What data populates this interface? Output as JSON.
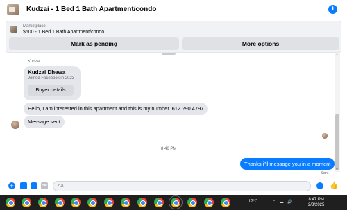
{
  "header": {
    "title": "Kudzai - 1 Bed 1 Bath Apartment/condo",
    "info_glyph": "i"
  },
  "marketplace": {
    "label": "Marketplace",
    "listing": "$600 - 1 Bed 1 Bath Apartment/condo",
    "pending_button": "Mark as pending",
    "more_button": "More options"
  },
  "messages": {
    "sender_small": "Kudzai",
    "profile_card": {
      "name": "Kudzai Dhewa",
      "joined": "Joined Facebook in 2023",
      "button": "Buyer details"
    },
    "incoming_1": "Hello, I am interested in this apartment and this is my number. 612 290 4797",
    "incoming_2": "Message sent",
    "timestamp": "8:46 PM",
    "outgoing": "Thanks i\"il message you in a moment",
    "sent_status": "Sent"
  },
  "composer": {
    "placeholder": "Aa",
    "gif_label": "GIF"
  },
  "taskbar": {
    "weather": "17°C",
    "time": "8:47 PM",
    "date": "2/3/2025"
  },
  "colors": {
    "accent": "#0a7cff",
    "bubble_incoming": "#e4e6eb",
    "taskbar": "#1f1f1f"
  }
}
